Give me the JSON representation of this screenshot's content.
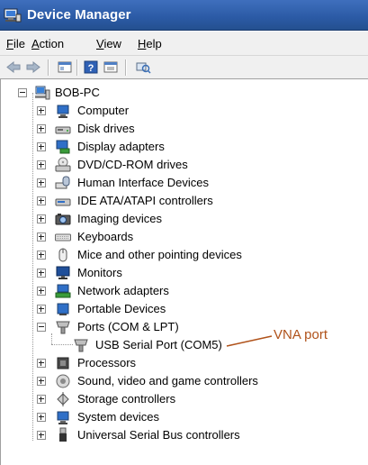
{
  "window": {
    "title": "Device Manager"
  },
  "menu": [
    {
      "mnemonic": "F",
      "rest": "ile"
    },
    {
      "mnemonic": "A",
      "rest": "ction"
    },
    {
      "mnemonic": "V",
      "rest": "iew"
    },
    {
      "mnemonic": "H",
      "rest": "elp"
    }
  ],
  "toolbar": [
    "back-icon",
    "forward-icon",
    "show-hide-tree-icon",
    "help-icon",
    "properties-icon",
    "scan-hardware-icon"
  ],
  "tree": {
    "root": "BOB-PC",
    "categories": [
      "Computer",
      "Disk drives",
      "Display adapters",
      "DVD/CD-ROM drives",
      "Human Interface Devices",
      "IDE ATA/ATAPI controllers",
      "Imaging devices",
      "Keyboards",
      "Mice and other pointing devices",
      "Monitors",
      "Network adapters",
      "Portable Devices",
      "Ports (COM & LPT)",
      "USB Serial Port (COM5)",
      "Processors",
      "Sound, video and game controllers",
      "Storage controllers",
      "System devices",
      "Universal Serial Bus controllers"
    ]
  },
  "annotation": {
    "text": "VNA port",
    "color": "#b0521a"
  }
}
